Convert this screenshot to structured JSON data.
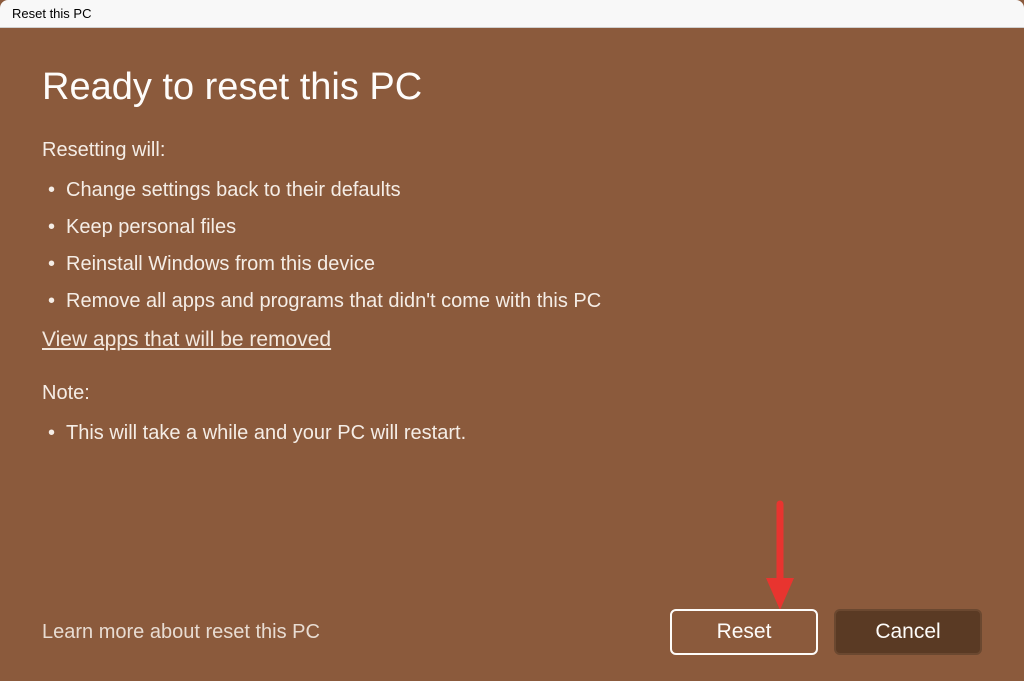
{
  "titlebar": {
    "title": "Reset this PC"
  },
  "heading": "Ready to reset this PC",
  "resetting": {
    "label": "Resetting will:",
    "items": [
      "Change settings back to their defaults",
      "Keep personal files",
      "Reinstall Windows from this device",
      "Remove all apps and programs that didn't come with this PC"
    ]
  },
  "view_apps_link": "View apps that will be removed",
  "note": {
    "label": "Note:",
    "items": [
      "This will take a while and your PC will restart."
    ]
  },
  "learn_more": "Learn more about reset this PC",
  "buttons": {
    "reset": "Reset",
    "cancel": "Cancel"
  }
}
